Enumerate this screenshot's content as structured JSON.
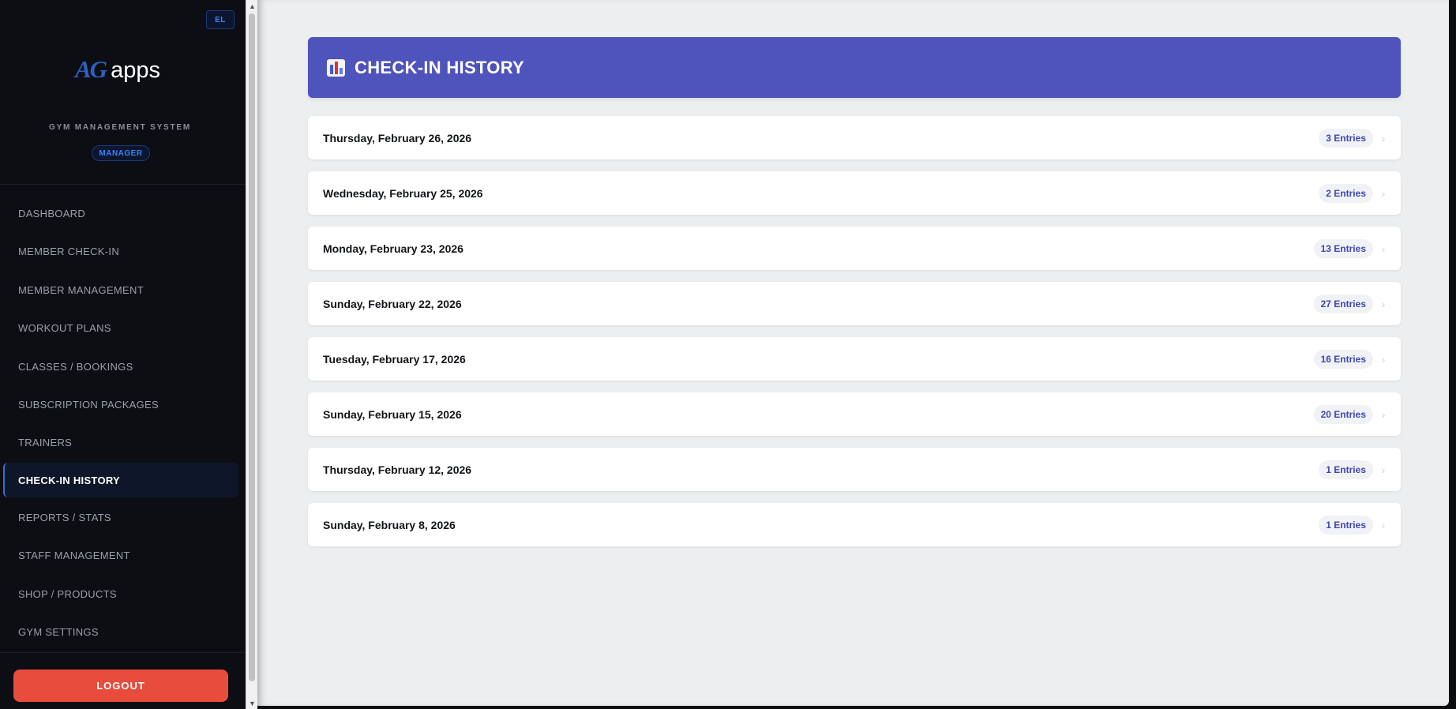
{
  "sidebar": {
    "lang_button": "EL",
    "logo": {
      "mark": "AG",
      "text": "apps"
    },
    "system_name": "GYM MANAGEMENT SYSTEM",
    "role": "MANAGER",
    "items": [
      {
        "label": "DASHBOARD",
        "active": false
      },
      {
        "label": "MEMBER CHECK-IN",
        "active": false
      },
      {
        "label": "MEMBER MANAGEMENT",
        "active": false
      },
      {
        "label": "WORKOUT PLANS",
        "active": false
      },
      {
        "label": "CLASSES / BOOKINGS",
        "active": false
      },
      {
        "label": "SUBSCRIPTION PACKAGES",
        "active": false
      },
      {
        "label": "TRAINERS",
        "active": false
      },
      {
        "label": "CHECK-IN HISTORY",
        "active": true
      },
      {
        "label": "REPORTS / STATS",
        "active": false
      },
      {
        "label": "STAFF MANAGEMENT",
        "active": false
      },
      {
        "label": "SHOP / PRODUCTS",
        "active": false
      },
      {
        "label": "GYM SETTINGS",
        "active": false
      }
    ],
    "logout_label": "LOGOUT"
  },
  "header": {
    "icon": "bar-chart-icon",
    "title": "CHECK-IN HISTORY"
  },
  "history": [
    {
      "date": "Thursday, February 26, 2026",
      "entries": "3 Entries"
    },
    {
      "date": "Wednesday, February 25, 2026",
      "entries": "2 Entries"
    },
    {
      "date": "Monday, February 23, 2026",
      "entries": "13 Entries"
    },
    {
      "date": "Sunday, February 22, 2026",
      "entries": "27 Entries"
    },
    {
      "date": "Tuesday, February 17, 2026",
      "entries": "16 Entries"
    },
    {
      "date": "Sunday, February 15, 2026",
      "entries": "20 Entries"
    },
    {
      "date": "Thursday, February 12, 2026",
      "entries": "1 Entries"
    },
    {
      "date": "Sunday, February 8, 2026",
      "entries": "1 Entries"
    }
  ],
  "colors": {
    "accent": "#4f53bc",
    "logout": "#e84c3d",
    "badge_text": "#3f46b0",
    "brand_blue": "#3b82f6"
  }
}
